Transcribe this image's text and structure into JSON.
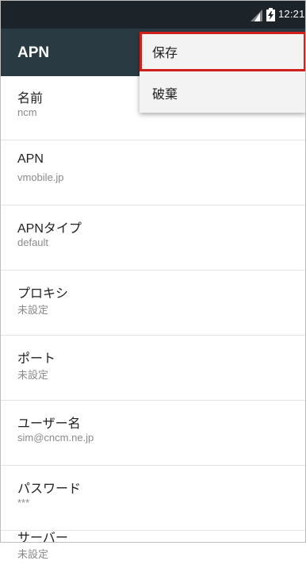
{
  "status_bar": {
    "time": "12:21",
    "signal_icon": "cell-signal-icon",
    "battery_icon": "battery-charging-icon"
  },
  "app_bar": {
    "title": "APN"
  },
  "menu": {
    "items": [
      {
        "label": "保存",
        "highlighted": true
      },
      {
        "label": "破棄",
        "highlighted": false
      }
    ],
    "highlight_color": "#d0201b"
  },
  "settings": [
    {
      "label": "名前",
      "value": "ncm"
    },
    {
      "label": "APN",
      "value": "vmobile.jp"
    },
    {
      "label": "APNタイプ",
      "value": "default"
    },
    {
      "label": "プロキシ",
      "value": "未設定"
    },
    {
      "label": "ポート",
      "value": "未設定"
    },
    {
      "label": "ユーザー名",
      "value": "sim@cncm.ne.jp"
    },
    {
      "label": "パスワード",
      "value": "***"
    },
    {
      "label": "サーバー",
      "value": "未設定"
    }
  ],
  "colors": {
    "status_bar_bg": "#1c2329",
    "app_bar_bg": "#2a3a43",
    "menu_bg": "#f3f3f3"
  }
}
